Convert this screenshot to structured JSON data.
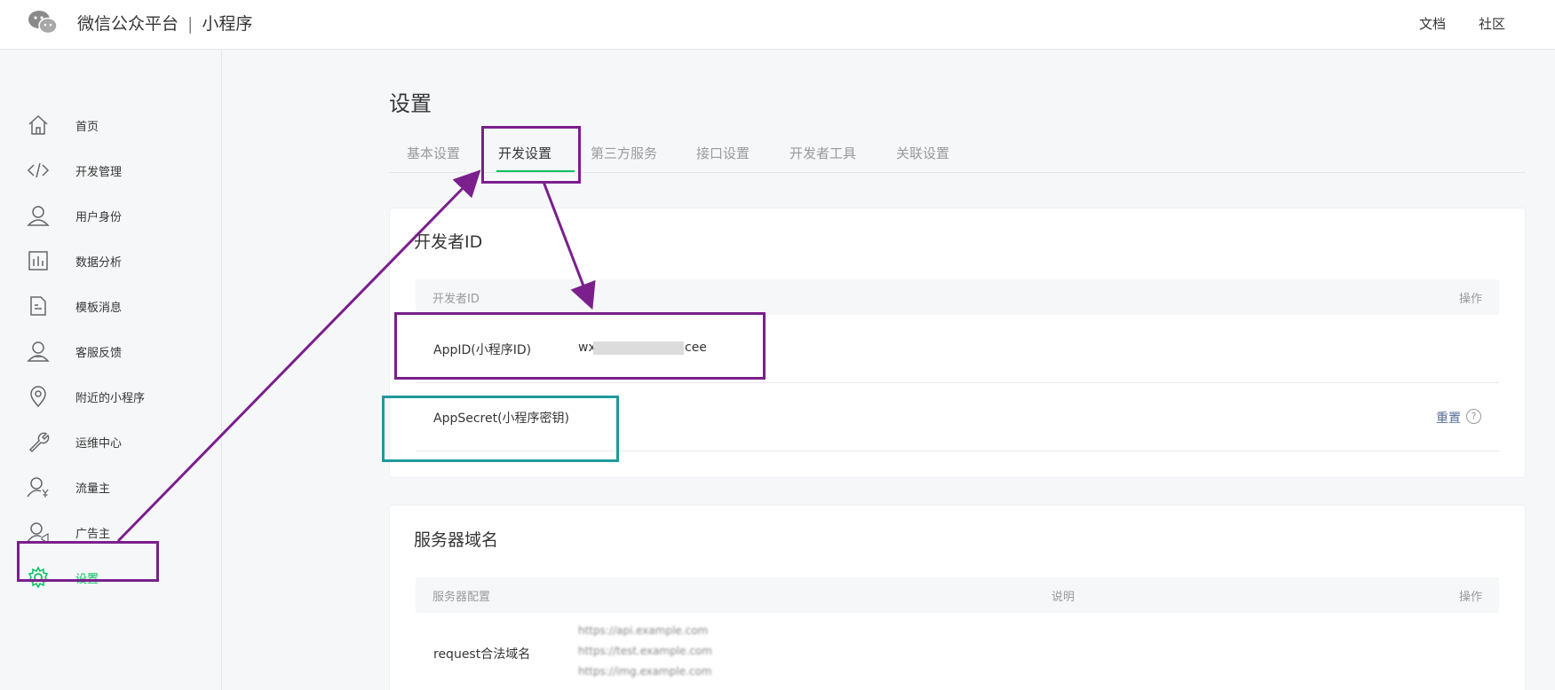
{
  "header": {
    "brand": "微信公众平台",
    "separator": "|",
    "product": "小程序",
    "links": [
      "文档",
      "社区"
    ]
  },
  "sidebar": {
    "items": [
      {
        "label": "首页",
        "icon": "home-icon"
      },
      {
        "label": "开发管理",
        "icon": "code-icon"
      },
      {
        "label": "用户身份",
        "icon": "user-icon"
      },
      {
        "label": "数据分析",
        "icon": "bar-chart-icon"
      },
      {
        "label": "模板消息",
        "icon": "document-icon"
      },
      {
        "label": "客服反馈",
        "icon": "service-user-icon"
      },
      {
        "label": "附近的小程序",
        "icon": "location-pin-icon"
      },
      {
        "label": "运维中心",
        "icon": "wrench-icon"
      },
      {
        "label": "流量主",
        "icon": "user-yen-icon"
      },
      {
        "label": "广告主",
        "icon": "user-megaphone-icon"
      },
      {
        "label": "设置",
        "icon": "gear-icon",
        "active": true
      }
    ]
  },
  "main": {
    "title": "设置",
    "tabs": [
      {
        "label": "基本设置"
      },
      {
        "label": "开发设置",
        "active": true
      },
      {
        "label": "第三方服务"
      },
      {
        "label": "接口设置"
      },
      {
        "label": "开发者工具"
      },
      {
        "label": "关联设置"
      }
    ],
    "developer_id": {
      "title": "开发者ID",
      "col_id": "开发者ID",
      "col_action": "操作",
      "appid_label": "AppID(小程序ID)",
      "appid_prefix": "wx",
      "appid_suffix": "cee",
      "secret_label": "AppSecret(小程序密钥)",
      "reset_label": "重置",
      "help_glyph": "?"
    },
    "server_domain": {
      "title": "服务器域名",
      "col_config": "服务器配置",
      "col_desc": "说明",
      "col_action": "操作",
      "request_label": "request合法域名",
      "blurred_domains": [
        "https://api.example.com",
        "https://test.example.com",
        "https://img.example.com"
      ]
    }
  },
  "colors": {
    "accent": "#07c160",
    "link": "#576b95",
    "annotation_purple": "#7a1f8c",
    "annotation_teal": "#1f9a9a"
  }
}
